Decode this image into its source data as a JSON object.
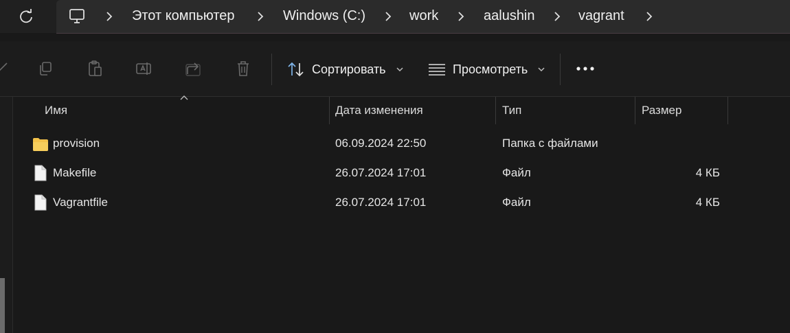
{
  "breadcrumbs": [
    "Этот компьютер",
    "Windows (C:)",
    "work",
    "aalushin",
    "vagrant"
  ],
  "toolbar": {
    "sort_label": "Сортировать",
    "view_label": "Просмотреть"
  },
  "columns": {
    "name": "Имя",
    "date": "Дата изменения",
    "type": "Тип",
    "size": "Размер"
  },
  "files": [
    {
      "name": "provision",
      "date": "06.09.2024 22:50",
      "type": "Папка с файлами",
      "size": "",
      "icon": "folder-icon"
    },
    {
      "name": "Makefile",
      "date": "26.07.2024 17:01",
      "type": "Файл",
      "size": "4 КБ",
      "icon": "file-icon"
    },
    {
      "name": "Vagrantfile",
      "date": "26.07.2024 17:01",
      "type": "Файл",
      "size": "4 КБ",
      "icon": "file-icon"
    }
  ],
  "colors": {
    "background": "#191919",
    "folder": "#f3c24a",
    "accent_border": "#4a3d44"
  }
}
